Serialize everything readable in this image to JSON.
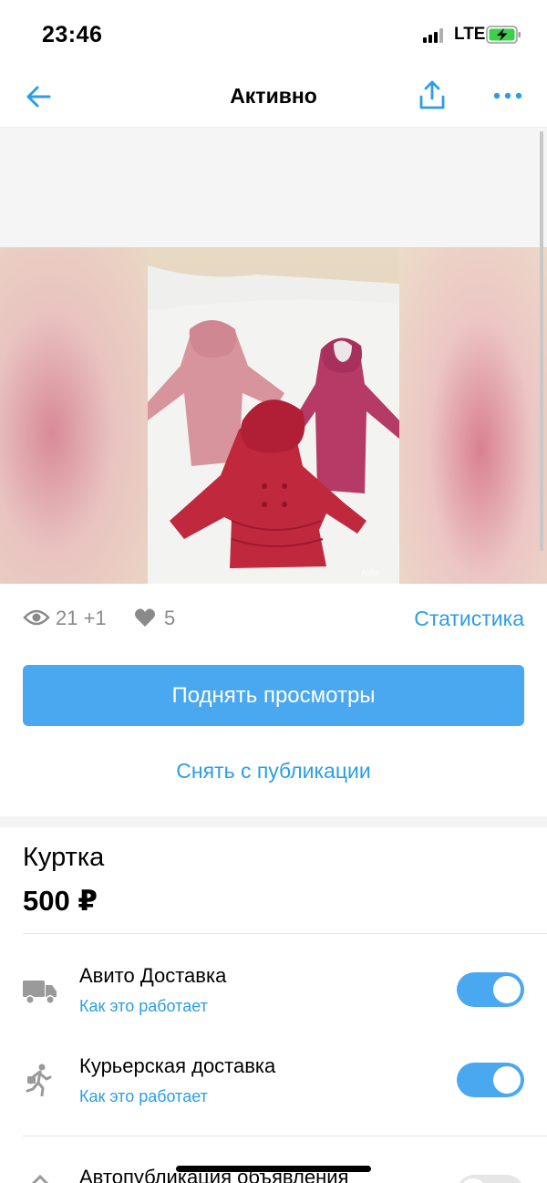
{
  "status_bar": {
    "time": "23:46",
    "network": "LTE",
    "icons": [
      "signal-icon",
      "battery-charging-icon"
    ]
  },
  "nav": {
    "title": "Активно",
    "icons": [
      "back-arrow-icon",
      "share-icon",
      "more-icon"
    ]
  },
  "photo": {
    "description_visible": false,
    "watermark": "Avito"
  },
  "stats": {
    "views": "21 +1",
    "likes": "5",
    "stats_link": "Статистика"
  },
  "actions": {
    "promote_button": "Поднять просмотры",
    "unpublish_button": "Снять с публикации"
  },
  "item": {
    "title": "Куртка",
    "price": "500 ₽"
  },
  "options": [
    {
      "label": "Авито Доставка",
      "link": "Как это работает",
      "enabled": true,
      "icon": "truck-icon"
    },
    {
      "label": "Курьерская доставка",
      "link": "Как это работает",
      "enabled": true,
      "icon": "courier-icon"
    },
    {
      "label": "Автопубликация объявления",
      "enabled": false,
      "icon": "autopublish-icon"
    }
  ],
  "colors": {
    "accent": "#4aa8f0",
    "link": "#2b9ee5",
    "muted": "#8a8a8a"
  }
}
